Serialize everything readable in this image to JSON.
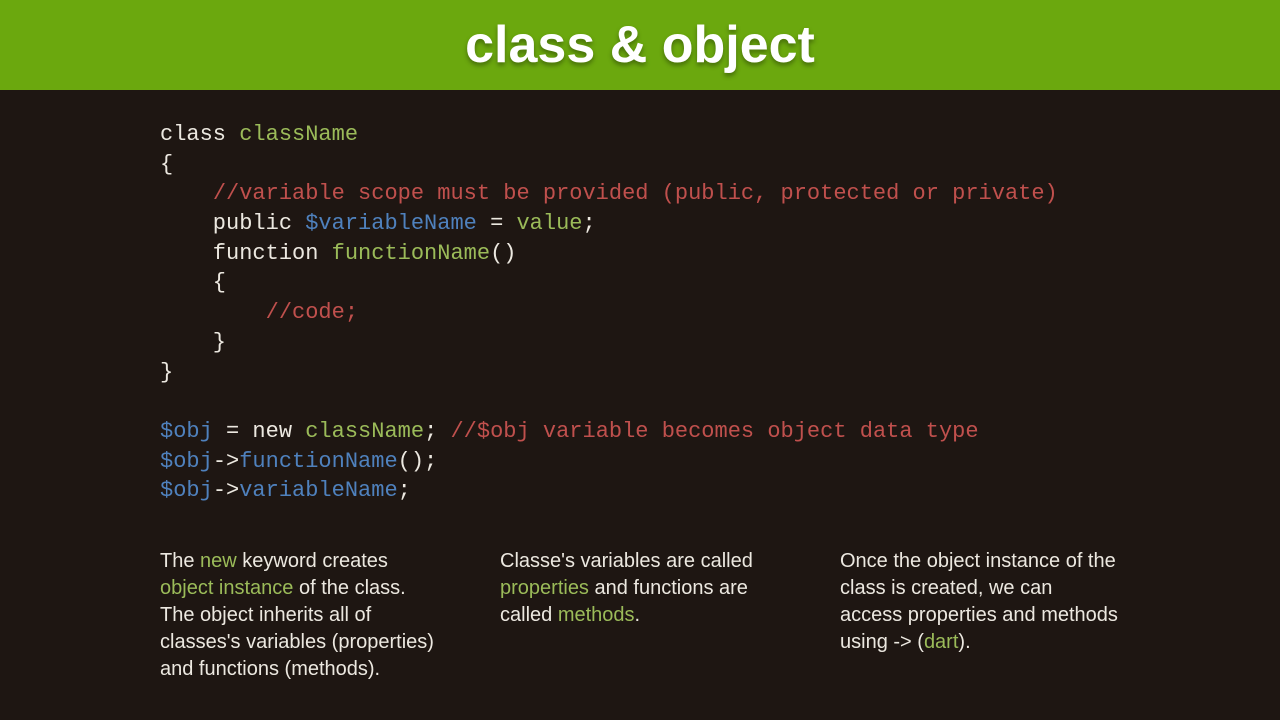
{
  "header": {
    "title": "class & object"
  },
  "code": {
    "l1_key": "class ",
    "l1_class": "className",
    "l2": "{",
    "l3": "    ",
    "l3_comment": "//variable scope must be provided (public, protected or private)",
    "l4_pre": "    public ",
    "l4_var": "$variableName",
    "l4_mid": " = ",
    "l4_val": "value",
    "l4_end": ";",
    "l5_pre": "    function ",
    "l5_func": "functionName",
    "l5_end": "()",
    "l6": "    {",
    "l7_pre": "        ",
    "l7_comment": "//code;",
    "l8": "    }",
    "l9": "}",
    "l10_obj": "$obj",
    "l10_mid": " = new ",
    "l10_class": "className",
    "l10_semi": "; ",
    "l10_comment": "//$obj variable becomes object data type",
    "l11_obj": "$obj",
    "l11_arrow": "->",
    "l11_func": "functionName",
    "l11_end": "();",
    "l12_obj": "$obj",
    "l12_arrow": "->",
    "l12_var": "variableName",
    "l12_end": ";"
  },
  "col1": {
    "t1": "The ",
    "h1": "new",
    "t2": " keyword creates ",
    "h2": "object instance",
    "t3": " of the class. The object inherits all of classes's variables (properties) and functions (methods)."
  },
  "col2": {
    "t1": "Classe's variables are called ",
    "h1": "properties",
    "t2": " and functions are called ",
    "h2": "methods",
    "t3": "."
  },
  "col3": {
    "t1": "Once the object instance of the class is created, we can access properties and methods using -> (",
    "h1": "dart",
    "t2": ")."
  }
}
